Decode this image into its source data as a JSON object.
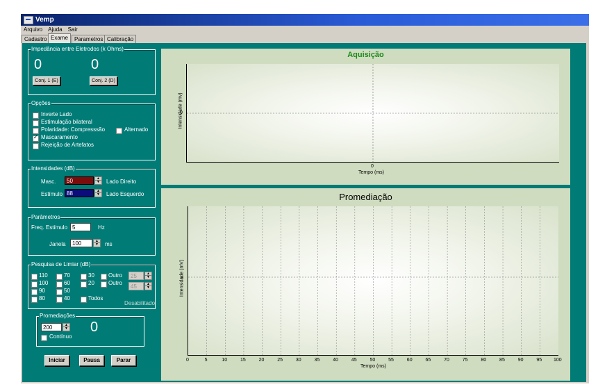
{
  "window": {
    "title": "Vemp"
  },
  "menu": [
    "Arquivo",
    "Ajuda",
    "Sair"
  ],
  "tabs": [
    "Cadastro",
    "Exame",
    "Parametros",
    "Calibração"
  ],
  "impedancia": {
    "title": "Impedância entre Eletrodos (k Ohms)",
    "left_value": "0",
    "right_value": "0",
    "btn_left": "Conj. 1 (E)",
    "btn_right": "Conj. 2 (D)"
  },
  "opcoes": {
    "title": "Opções",
    "items": [
      {
        "label": "Inverte Lado",
        "checked": false
      },
      {
        "label": "Estimulação bilateral",
        "checked": false
      },
      {
        "label": "Polaridade: Compresssão",
        "checked": false
      },
      {
        "label": "Mascaramento",
        "checked": true
      },
      {
        "label": "Rejeição de Artefatos",
        "checked": false
      }
    ],
    "alternado": {
      "label": "Alternado",
      "checked": false
    }
  },
  "intensidades": {
    "title": "Intensidades (dB)",
    "masc_label": "Masc.",
    "masc_value": "50",
    "masc_side": "Lado Direito",
    "estimulo_label": "Estímulo",
    "estimulo_value": "88",
    "estimulo_side": "Lado Esquerdo",
    "masc_color": "#7a0c0c",
    "estimulo_color": "#0c0c7a"
  },
  "parametros": {
    "title": "Parâmetros",
    "freq_label": "Freq. Estímulo",
    "freq_value": "5",
    "freq_unit": "Hz",
    "janela_label": "Janela",
    "janela_value": "100",
    "janela_unit": "ms"
  },
  "limiar": {
    "title": "Pesquisa de Limiar (dB)",
    "col1": [
      "110",
      "100",
      "90",
      "80"
    ],
    "col2": [
      "70",
      "60",
      "50",
      "40"
    ],
    "col3": [
      "30",
      "20"
    ],
    "outro1": "Outro",
    "outro2": "Outro",
    "outro1_value": "25",
    "outro2_value": "45",
    "todos": "Todos",
    "status": "Desabilitado"
  },
  "promediacoes": {
    "title": "Promediações",
    "value": "200",
    "continuo": "Contínuo",
    "count": "0"
  },
  "buttons": {
    "iniciar": "Iniciar",
    "pausa": "Pausa",
    "parar": "Parar"
  },
  "aquisicao": {
    "title": "Aquisição",
    "title_color": "#1a8a1a",
    "ylabel": "Intensidade (mv)",
    "xlabel": "Tempo (ms)",
    "y_tick": "0",
    "x_tick": "0"
  },
  "promediacao": {
    "title": "Promediação",
    "ylabel": "Intensidade (mV)",
    "xlabel": "Tempo (ms)",
    "y_tick": "0",
    "x_ticks": [
      "0",
      "5",
      "10",
      "15",
      "20",
      "25",
      "30",
      "35",
      "40",
      "45",
      "50",
      "55",
      "60",
      "65",
      "70",
      "75",
      "80",
      "85",
      "90",
      "95",
      "100"
    ]
  },
  "colors": {
    "client_bg": "#007b76",
    "plot_panel": "#cfdcc0",
    "titlebar": "#0a246a"
  }
}
